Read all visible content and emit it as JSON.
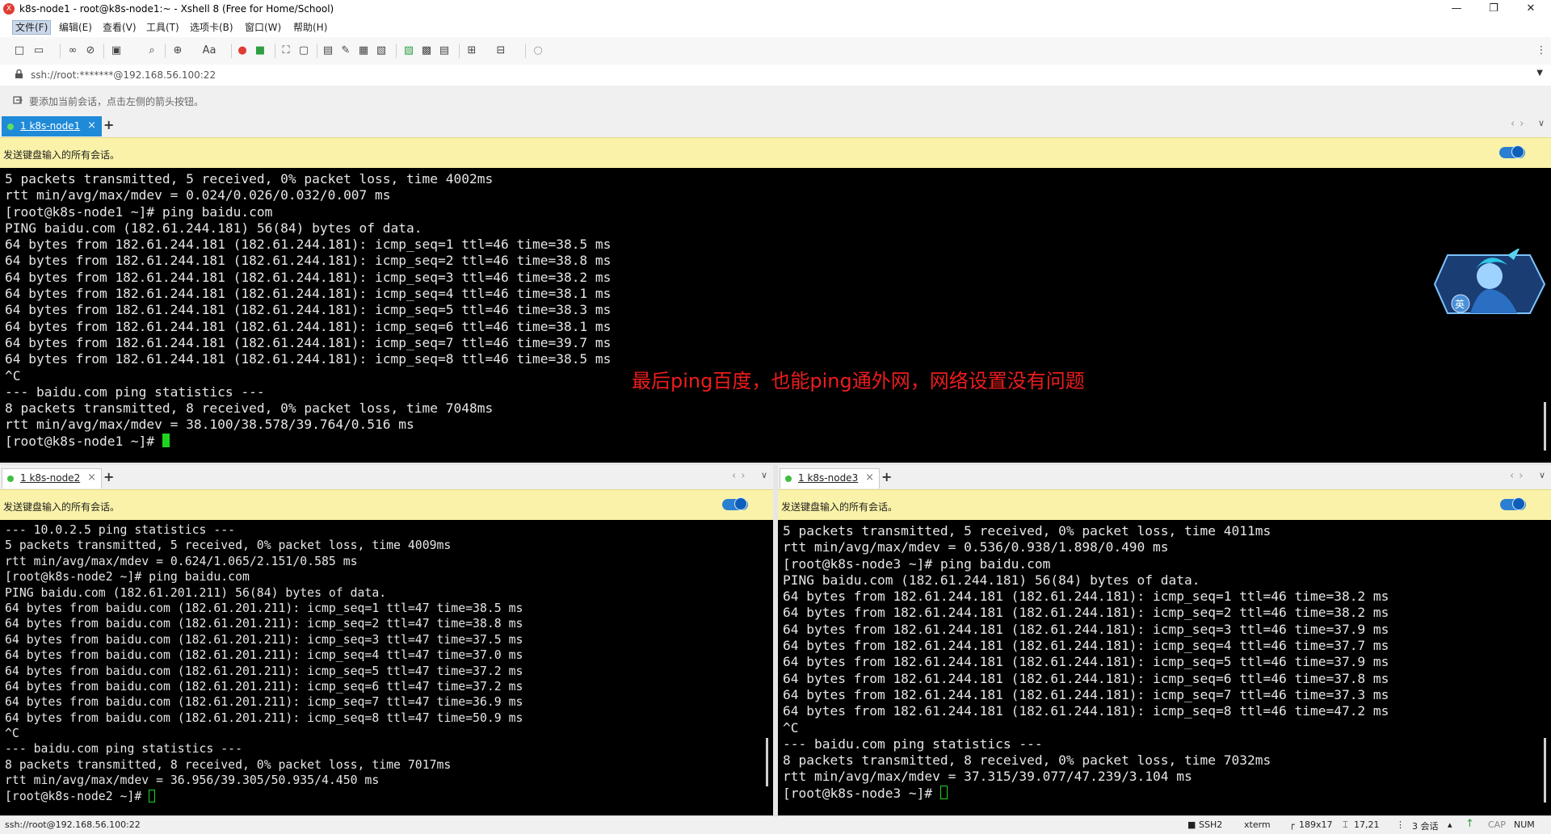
{
  "window": {
    "title": "k8s-node1 - root@k8s-node1:~ - Xshell 8 (Free for Home/School)",
    "app_icon": "xshell-logo-icon",
    "controls": [
      "minimize-icon",
      "maximize-icon",
      "close-icon"
    ]
  },
  "menu": {
    "items": [
      "文件(F)",
      "编辑(E)",
      "查看(V)",
      "工具(T)",
      "选项卡(B)",
      "窗口(W)",
      "帮助(H)"
    ]
  },
  "toolbar": {
    "icons": [
      "new-session-icon",
      "open-folder-icon",
      "connect-icon",
      "disconnect-icon",
      "new-tab-icon",
      "find-icon",
      "globe-icon",
      "font-icon",
      "xftp-icon",
      "xagent-icon",
      "fullscreen-icon",
      "lock-icon",
      "compose-icon",
      "highlight-icon",
      "script-icon",
      "keyboard-icon",
      "transfer-icon",
      "log-icon",
      "copy-icon",
      "new-window-icon",
      "layout-icon",
      "chat-icon"
    ],
    "font_label": "Aa"
  },
  "address": {
    "value": "ssh://root:*******@192.168.56.100:22"
  },
  "hint": {
    "text": "要添加当前会话，点击左侧的箭头按钮。"
  },
  "broadcast": {
    "text": "发送键盘输入的所有会话。"
  },
  "panes": {
    "node1": {
      "tab_label": "1 k8s-node1",
      "lines": [
        "5 packets transmitted, 5 received, 0% packet loss, time 4002ms",
        "rtt min/avg/max/mdev = 0.024/0.026/0.032/0.007 ms",
        "[root@k8s-node1 ~]# ping baidu.com",
        "PING baidu.com (182.61.244.181) 56(84) bytes of data.",
        "64 bytes from 182.61.244.181 (182.61.244.181): icmp_seq=1 ttl=46 time=38.5 ms",
        "64 bytes from 182.61.244.181 (182.61.244.181): icmp_seq=2 ttl=46 time=38.8 ms",
        "64 bytes from 182.61.244.181 (182.61.244.181): icmp_seq=3 ttl=46 time=38.2 ms",
        "64 bytes from 182.61.244.181 (182.61.244.181): icmp_seq=4 ttl=46 time=38.1 ms",
        "64 bytes from 182.61.244.181 (182.61.244.181): icmp_seq=5 ttl=46 time=38.3 ms",
        "64 bytes from 182.61.244.181 (182.61.244.181): icmp_seq=6 ttl=46 time=38.1 ms",
        "64 bytes from 182.61.244.181 (182.61.244.181): icmp_seq=7 ttl=46 time=39.7 ms",
        "64 bytes from 182.61.244.181 (182.61.244.181): icmp_seq=8 ttl=46 time=38.5 ms",
        "^C",
        "--- baidu.com ping statistics ---",
        "8 packets transmitted, 8 received, 0% packet loss, time 7048ms",
        "rtt min/avg/max/mdev = 38.100/38.578/39.764/0.516 ms"
      ],
      "prompt": "[root@k8s-node1 ~]# ",
      "cursor": "filled"
    },
    "node2": {
      "tab_label": "1 k8s-node2",
      "lines": [
        "--- 10.0.2.5 ping statistics ---",
        "5 packets transmitted, 5 received, 0% packet loss, time 4009ms",
        "rtt min/avg/max/mdev = 0.624/1.065/2.151/0.585 ms",
        "[root@k8s-node2 ~]# ping baidu.com",
        "PING baidu.com (182.61.201.211) 56(84) bytes of data.",
        "64 bytes from baidu.com (182.61.201.211): icmp_seq=1 ttl=47 time=38.5 ms",
        "64 bytes from baidu.com (182.61.201.211): icmp_seq=2 ttl=47 time=38.8 ms",
        "64 bytes from baidu.com (182.61.201.211): icmp_seq=3 ttl=47 time=37.5 ms",
        "64 bytes from baidu.com (182.61.201.211): icmp_seq=4 ttl=47 time=37.0 ms",
        "64 bytes from baidu.com (182.61.201.211): icmp_seq=5 ttl=47 time=37.2 ms",
        "64 bytes from baidu.com (182.61.201.211): icmp_seq=6 ttl=47 time=37.2 ms",
        "64 bytes from baidu.com (182.61.201.211): icmp_seq=7 ttl=47 time=36.9 ms",
        "64 bytes from baidu.com (182.61.201.211): icmp_seq=8 ttl=47 time=50.9 ms",
        "^C",
        "--- baidu.com ping statistics ---",
        "8 packets transmitted, 8 received, 0% packet loss, time 7017ms",
        "rtt min/avg/max/mdev = 36.956/39.305/50.935/4.450 ms"
      ],
      "prompt": "[root@k8s-node2 ~]# ",
      "cursor": "outline"
    },
    "node3": {
      "tab_label": "1 k8s-node3",
      "lines": [
        "5 packets transmitted, 5 received, 0% packet loss, time 4011ms",
        "rtt min/avg/max/mdev = 0.536/0.938/1.898/0.490 ms",
        "[root@k8s-node3 ~]# ping baidu.com",
        "PING baidu.com (182.61.244.181) 56(84) bytes of data.",
        "64 bytes from 182.61.244.181 (182.61.244.181): icmp_seq=1 ttl=46 time=38.2 ms",
        "64 bytes from 182.61.244.181 (182.61.244.181): icmp_seq=2 ttl=46 time=38.2 ms",
        "64 bytes from 182.61.244.181 (182.61.244.181): icmp_seq=3 ttl=46 time=37.9 ms",
        "64 bytes from 182.61.244.181 (182.61.244.181): icmp_seq=4 ttl=46 time=37.7 ms",
        "64 bytes from 182.61.244.181 (182.61.244.181): icmp_seq=5 ttl=46 time=37.9 ms",
        "64 bytes from 182.61.244.181 (182.61.244.181): icmp_seq=6 ttl=46 time=37.8 ms",
        "64 bytes from 182.61.244.181 (182.61.244.181): icmp_seq=7 ttl=46 time=37.3 ms",
        "64 bytes from 182.61.244.181 (182.61.244.181): icmp_seq=8 ttl=46 time=47.2 ms",
        "^C",
        "--- baidu.com ping statistics ---",
        "8 packets transmitted, 8 received, 0% packet loss, time 7032ms",
        "rtt min/avg/max/mdev = 37.315/39.077/47.239/3.104 ms"
      ],
      "prompt": "[root@k8s-node3 ~]# ",
      "cursor": "outline"
    }
  },
  "annotation": {
    "text": "最后ping百度，也能ping通外网，网络设置没有问题",
    "color": "#ee1c1c"
  },
  "floating_widget": {
    "badge": "英",
    "icon": "anime-character-avatar-icon"
  },
  "status": {
    "address": "ssh://root@192.168.56.100:22",
    "protocol": "SSH2",
    "terminal": "xterm",
    "size": "189x17",
    "position": "17,21",
    "sessions": "3 会话",
    "caps": "CAP",
    "num": "NUM"
  },
  "colors": {
    "active_tab": "#1f8ad8",
    "broadcast_bar": "#faf2a8",
    "toggle": "#2b7fd3",
    "cursor": "#1fd41f",
    "terminal_bg": "#000000",
    "terminal_fg": "#e6e6e6"
  }
}
